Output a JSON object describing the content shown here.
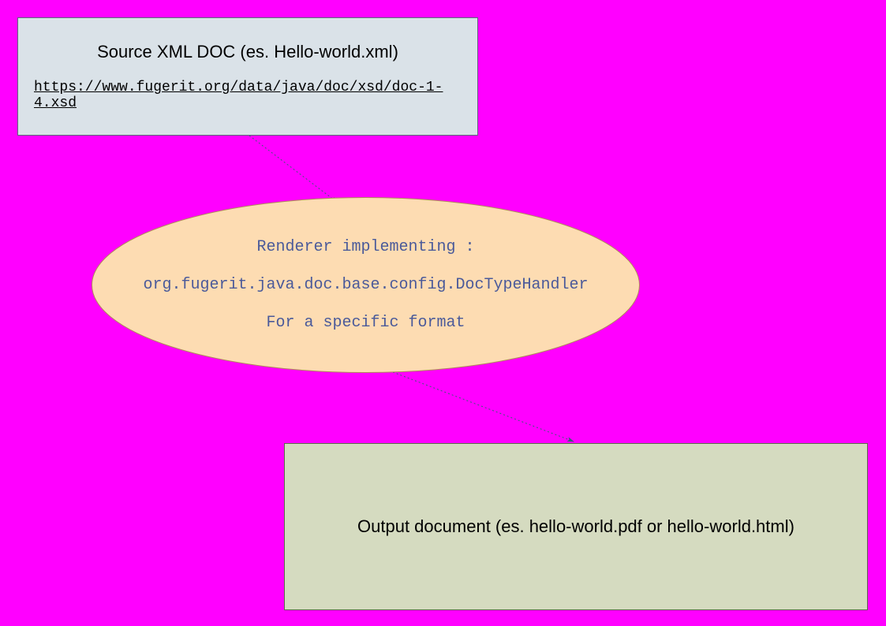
{
  "source_box": {
    "title": "Source XML DOC (es. Hello-world.xml)",
    "link": "https://www.fugerit.org/data/java/doc/xsd/doc-1-4.xsd"
  },
  "renderer_ellipse": {
    "line1": "Renderer implementing :",
    "line2": "org.fugerit.java.doc.base.config.DocTypeHandler",
    "line3": "For a specific format"
  },
  "output_box": {
    "text": "Output document (es. hello-world.pdf or hello-world.html)"
  },
  "colors": {
    "background": "#ff00ff",
    "box1_fill": "#dae2e8",
    "ellipse_fill": "#fddcb2",
    "box3_fill": "#d5dbc0",
    "ellipse_text": "#4a5a9a",
    "arrow_stroke": "#3a5a7a"
  }
}
